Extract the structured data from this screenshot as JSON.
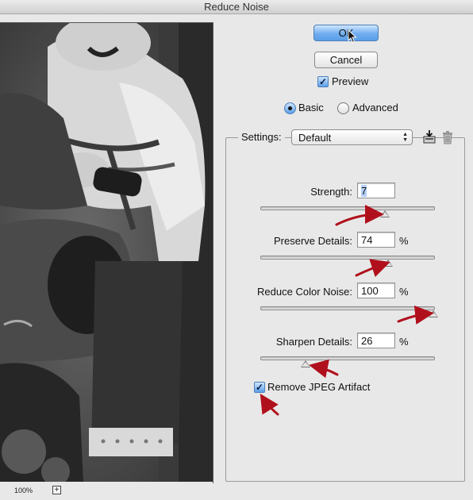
{
  "window": {
    "title": "Reduce Noise"
  },
  "preview": {
    "zoom_label": "100%",
    "zoom_in_symbol": "+"
  },
  "buttons": {
    "ok": "OK",
    "cancel": "Cancel"
  },
  "preview_toggle": {
    "label": "Preview",
    "checked": true
  },
  "mode": {
    "options": [
      "Basic",
      "Advanced"
    ],
    "selected": "Basic"
  },
  "settings": {
    "label": "Settings:",
    "value": "Default"
  },
  "sliders": [
    {
      "label": "Strength:",
      "value": "7",
      "unit": "",
      "level": 0.72
    },
    {
      "label": "Preserve Details:",
      "value": "74",
      "unit": "%",
      "level": 0.74
    },
    {
      "label": "Reduce Color Noise:",
      "value": "100",
      "unit": "%",
      "level": 1.0
    },
    {
      "label": "Sharpen Details:",
      "value": "26",
      "unit": "%",
      "level": 0.26
    }
  ],
  "jpeg": {
    "label": "Remove JPEG Artifact",
    "checked": true
  },
  "colors": {
    "accent": "#5a9ee8",
    "annotation_arrow": "#b0101c"
  },
  "icons": [
    "save-settings-icon",
    "delete-settings-icon",
    "cursor-icon",
    "zoom-in-icon"
  ]
}
